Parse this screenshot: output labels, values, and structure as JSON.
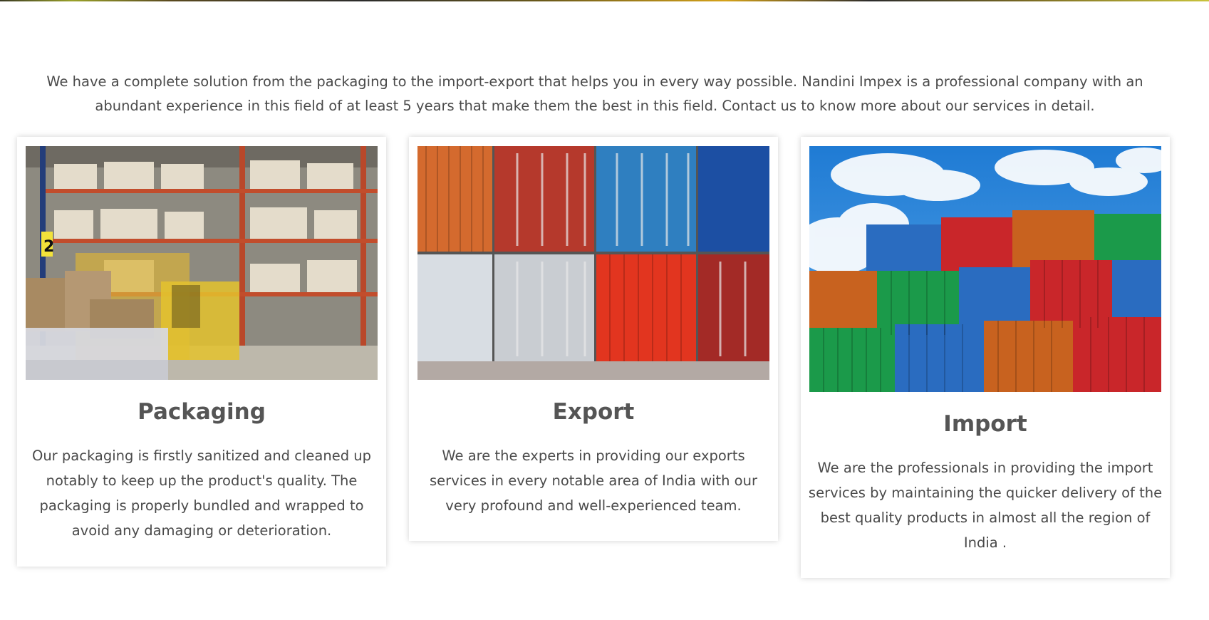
{
  "intro": {
    "text": "We have a complete solution from the packaging to the import-export that helps you in every way possible. Nandini Impex is a professional company with an abundant experience in this field of at least 5 years that make them the best in this field. Contact us to know more about our services in detail."
  },
  "cards": [
    {
      "title": "Packaging",
      "description": "Our packaging is firstly sanitized and cleaned up notably to keep up the product's quality. The packaging is properly bundled and wrapped to avoid any damaging or deterioration.",
      "image": "warehouse-shelves-photo",
      "photo_text": "2"
    },
    {
      "title": "Export",
      "description": "We are the experts in providing our exports services in every notable area of India with our very profound and well-experienced team.",
      "image": "container-doors-photo"
    },
    {
      "title": "Import",
      "description": "We are the professionals in providing the import services by maintaining the quicker delivery of the best quality products in almost all the region of India .",
      "image": "stacked-containers-sky-photo"
    }
  ],
  "colors": {
    "heading": "#555555",
    "body_text": "#4a4a4a",
    "card_bg": "#ffffff"
  }
}
